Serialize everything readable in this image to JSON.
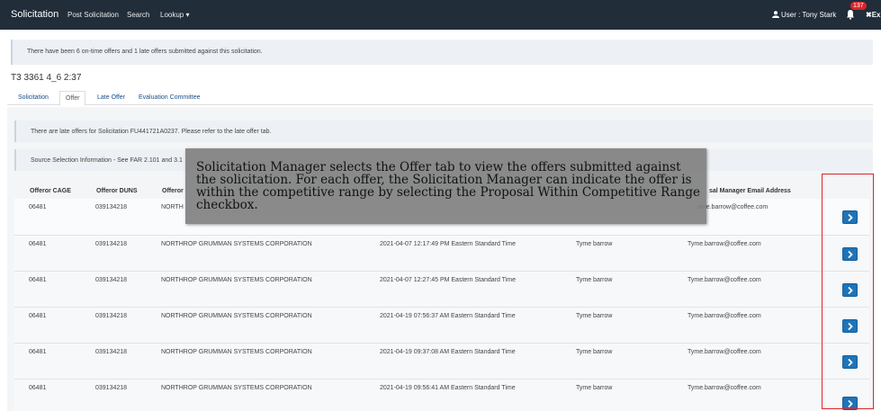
{
  "nav": {
    "brand": "Solicitation",
    "items": [
      "Post Solicitation",
      "Search",
      "Lookup ▾"
    ],
    "user": "User : Tony Stark",
    "notification_count": "137",
    "exit": "✖Ex"
  },
  "alerts": {
    "offers_summary": "There have been 6 on-time offers and 1 late offers submitted against this solicitation.",
    "late_offers": "There are late offers for Solicitation FU441721A0237. Please refer to the late offer tab.",
    "source_selection": "Source Selection Information - See FAR 2.101 and 3.1"
  },
  "solicitation_title": "T3 3361 4_6 2:37",
  "tabs": [
    "Solicitation",
    "Offer",
    "Late Offer",
    "Evaluation Committee"
  ],
  "table": {
    "headers": [
      "Offeror CAGE",
      "Offeror DUNS",
      "Offeror",
      "sal Manager Email Address"
    ],
    "rows": [
      {
        "cage": "06481",
        "duns": "039134218",
        "offeror": "NORTH",
        "date": "",
        "manager": "",
        "email": "ame.barrow@coffee.com"
      },
      {
        "cage": "06481",
        "duns": "039134218",
        "offeror": "NORTHROP GRUMMAN SYSTEMS CORPORATION",
        "date": "2021-04-07 12:17:49 PM Eastern Standard Time",
        "manager": "Tyme barrow",
        "email": "Tyme.barrow@coffee.com"
      },
      {
        "cage": "06481",
        "duns": "039134218",
        "offeror": "NORTHROP GRUMMAN SYSTEMS CORPORATION",
        "date": "2021-04-07 12:27:45 PM Eastern Standard Time",
        "manager": "Tyme barrow",
        "email": "Tyme.barrow@coffee.com"
      },
      {
        "cage": "06481",
        "duns": "039134218",
        "offeror": "NORTHROP GRUMMAN SYSTEMS CORPORATION",
        "date": "2021-04-19 07:56:37 AM Eastern Standard Time",
        "manager": "Tyme barrow",
        "email": "Tyme.barrow@coffee.com"
      },
      {
        "cage": "06481",
        "duns": "039134218",
        "offeror": "NORTHROP GRUMMAN SYSTEMS CORPORATION",
        "date": "2021-04-19 09:37:08 AM Eastern Standard Time",
        "manager": "Tyme barrow",
        "email": "Tyme.barrow@coffee.com"
      },
      {
        "cage": "06481",
        "duns": "039134218",
        "offeror": "NORTHROP GRUMMAN SYSTEMS CORPORATION",
        "date": "2021-04-19 09:56:41 AM Eastern Standard Time",
        "manager": "Tyme barrow",
        "email": "Tyme.barrow@coffee.com"
      }
    ]
  },
  "tooltip": "Solicitation Manager selects the Offer tab to view the offers submitted against the solicitation. For each offer, the Solicitation Manager can indicate the offer is within the competitive range by selecting the Proposal Within Competitive Range checkbox.",
  "colors": {
    "navbar": "#222d3a",
    "button": "#1e74b8",
    "highlight": "#d9262c",
    "badge": "#d9262c"
  }
}
